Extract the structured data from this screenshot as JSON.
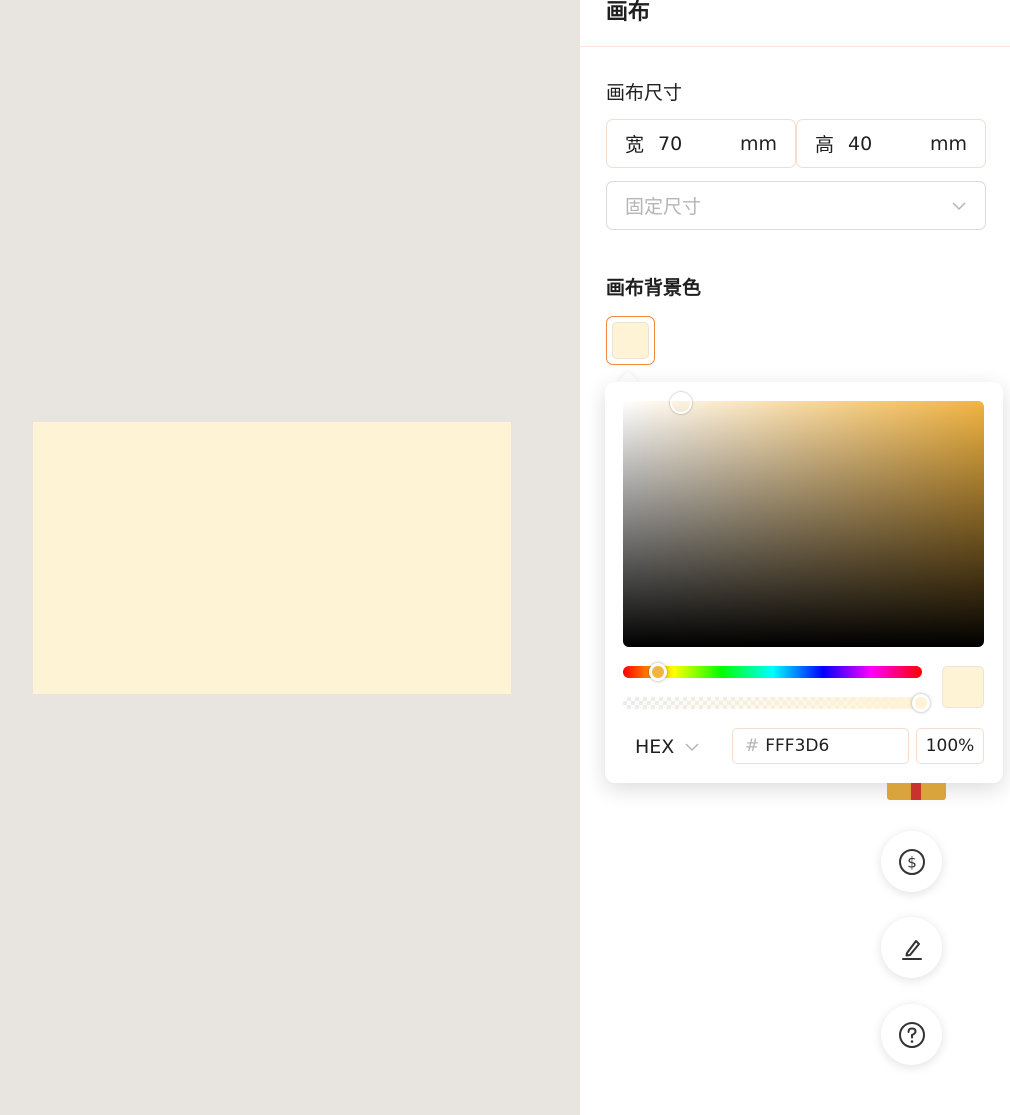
{
  "panel": {
    "title": "画布",
    "size_label": "画布尺寸",
    "width": {
      "prefix": "宽",
      "value": "70",
      "unit": "mm"
    },
    "height": {
      "prefix": "高",
      "value": "40",
      "unit": "mm"
    },
    "size_select_placeholder": "固定尺寸",
    "bg_label": "画布背景色"
  },
  "canvas": {
    "background_color": "#FFF3D6"
  },
  "color_picker": {
    "format": "HEX",
    "hash": "#",
    "hex_value": "FFF3D6",
    "alpha": "100%",
    "hue_color": "#F2B441",
    "selected_color": "#FFF3D6"
  },
  "fabs": [
    {
      "icon": "dollar-icon"
    },
    {
      "icon": "pen-icon"
    },
    {
      "icon": "help-icon"
    }
  ]
}
